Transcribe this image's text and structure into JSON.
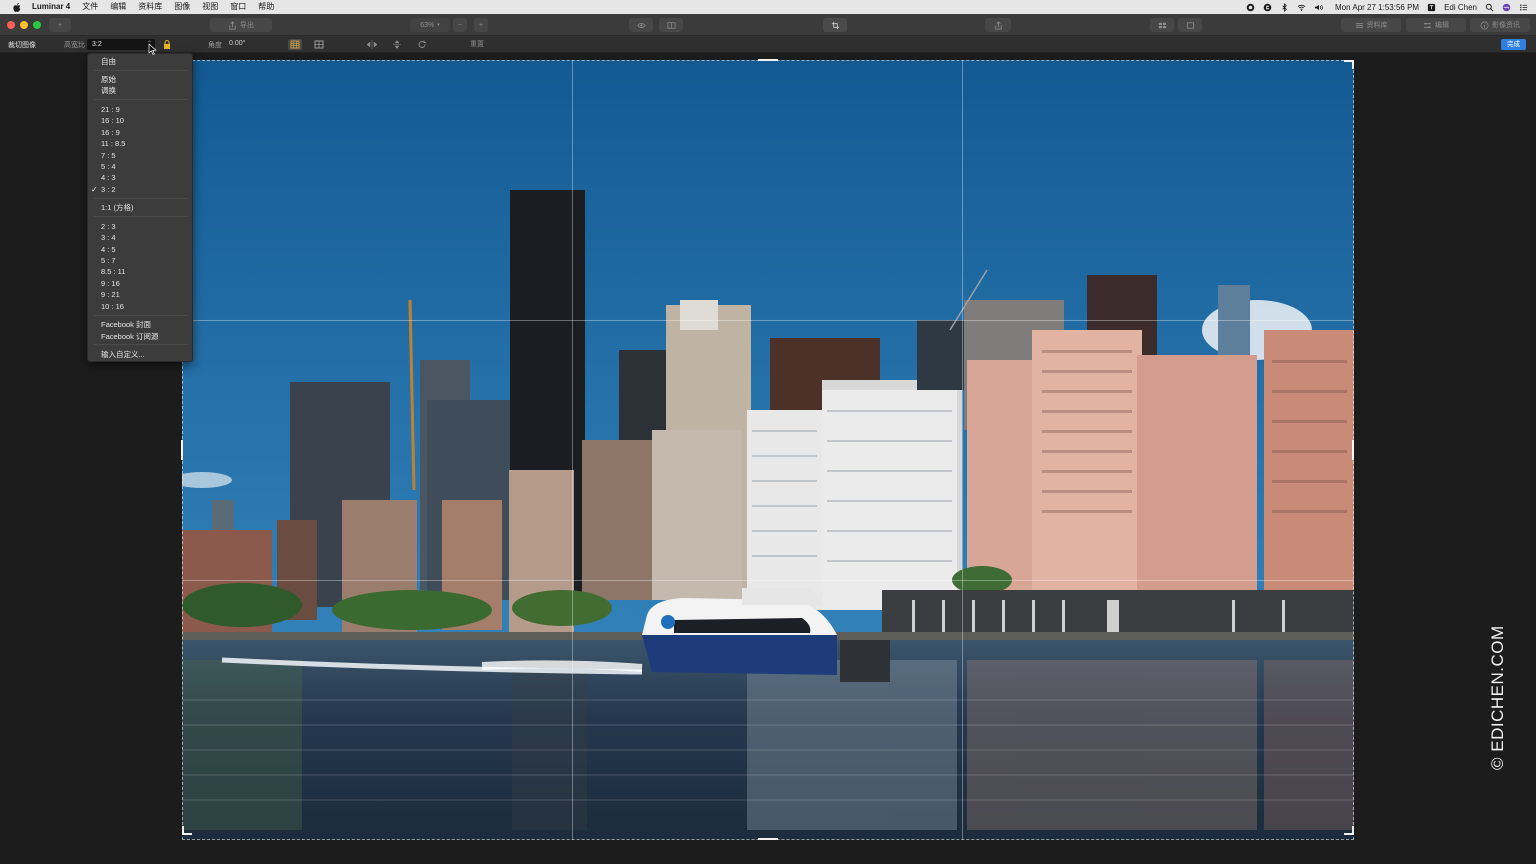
{
  "menubar": {
    "app_name": "Luminar 4",
    "menus": [
      "文件",
      "编辑",
      "资料库",
      "图像",
      "视图",
      "窗口",
      "帮助"
    ],
    "clock": "Mon Apr 27  1:53:56 PM",
    "user": "Edi Chen"
  },
  "toolbar": {
    "add_label": "+",
    "export_label": "导出",
    "zoom_value": "63%",
    "zoom_out": "−",
    "zoom_in": "+",
    "library_label": "资料库",
    "edit_label": "编辑",
    "info_label": "影像资讯"
  },
  "crop_bar": {
    "tool_title": "裁切图像",
    "ratio_label": "高宽比",
    "ratio_value": "3:2",
    "angle_label": "角度",
    "angle_value": "0.00°",
    "reset_label": "重置",
    "done_label": "完成"
  },
  "dropdown": {
    "free": "自由",
    "original": "原始",
    "swap": "调换",
    "landscape": [
      "21 : 9",
      "16 : 10",
      "16 : 9",
      "11 : 8.5",
      "7 : 5",
      "5 : 4",
      "4 : 3",
      "3 : 2"
    ],
    "square": "1:1 (方格)",
    "portrait": [
      "2 : 3",
      "3 : 4",
      "4 : 5",
      "5 : 7",
      "8.5 : 11",
      "9 : 16",
      "9 : 21",
      "10 : 16"
    ],
    "social": [
      "Facebook 封面",
      "Facebook 订阅源"
    ],
    "custom": "输入自定义...",
    "selected": "3 : 2",
    "check_mark": "✓"
  },
  "watermark": "© EDICHEN.COM",
  "colors": {
    "accent": "#2f7fe0",
    "sky_top": "#135a93",
    "sky_bottom": "#3d8fc6",
    "water": "#24374c"
  }
}
